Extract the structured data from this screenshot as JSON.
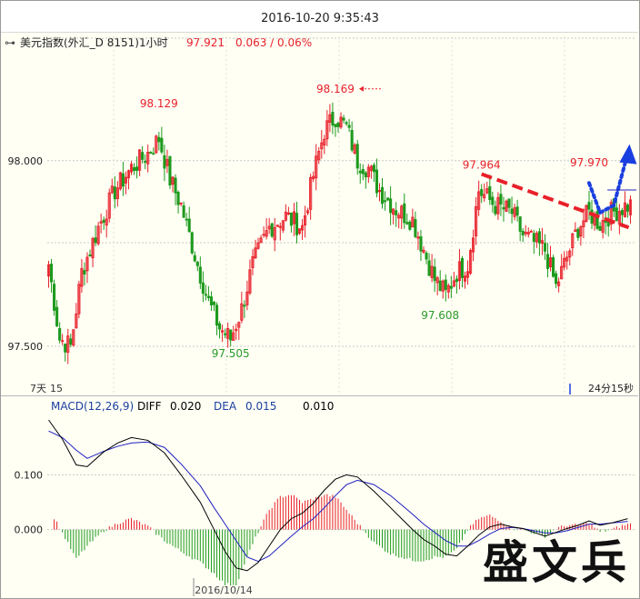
{
  "header": {
    "datetime": "2016-10-20 9:35:43",
    "menu_glyph": "⊶",
    "instrument": "美元指数(外汇_D 8151)1小时",
    "last_price": "97.921",
    "change": "0.063 / 0.06%"
  },
  "footer": {
    "countdown": "24分15秒",
    "left_fragment": "7天",
    "left_value": "15",
    "date_label": "2016/10/14"
  },
  "watermark": {
    "text": "盛文兵"
  },
  "colors": {
    "up": "#e8202a",
    "down": "#1e9a1e",
    "price_red": "#e8202a",
    "price_green": "#2a9a2a",
    "trendline": "#e8202a",
    "forecast_arrow": "#1a3fe0",
    "macd_line": "#000000",
    "signal_line": "#2020c0",
    "grid": "#c8c8c8",
    "panel_bg": "#fffff4"
  },
  "chart_data": [
    {
      "type": "candlestick",
      "yticks": [
        97.5,
        98.0
      ],
      "ytick_labels": [
        "97.500",
        "98.000"
      ],
      "ylim": [
        97.38,
        98.33
      ],
      "grid": true,
      "annotations": [
        {
          "text": "98.129",
          "x": 40,
          "y": 98.129,
          "color": "red"
        },
        {
          "text": "98.169",
          "x": 104,
          "y": 98.169,
          "color": "red"
        },
        {
          "text": "97.505",
          "x": 66,
          "y": 97.505,
          "color": "green"
        },
        {
          "text": "97.608",
          "x": 142,
          "y": 97.608,
          "color": "green"
        },
        {
          "text": "97.964",
          "x": 157,
          "y": 97.964,
          "color": "red"
        },
        {
          "text": "97.970",
          "x": 196,
          "y": 97.97,
          "color": "red"
        }
      ],
      "trendline": {
        "from": [
          157,
          97.964
        ],
        "to": [
          213,
          97.82
        ],
        "style": "dashed"
      },
      "forecast": {
        "points": [
          [
            196,
            97.94
          ],
          [
            200,
            97.86
          ],
          [
            205,
            97.88
          ],
          [
            210,
            98.02
          ]
        ],
        "style": "dotted-arrow"
      }
    },
    {
      "type": "macd",
      "title": "MACD(12,26,9)",
      "params": {
        "fast": 12,
        "slow": 26,
        "signal": 9
      },
      "diff_label": "DIFF",
      "diff": "0.020",
      "dea_label": "DEA",
      "dea": "0.015",
      "macd_value": "0.010",
      "yticks": [
        0.0,
        0.1
      ],
      "ytick_labels": [
        "0.000",
        "0.100"
      ],
      "ylim": [
        -0.12,
        0.24
      ],
      "diff_series": [
        [
          0,
          0.2
        ],
        [
          5,
          0.165
        ],
        [
          10,
          0.118
        ],
        [
          14,
          0.115
        ],
        [
          20,
          0.142
        ],
        [
          25,
          0.158
        ],
        [
          30,
          0.168
        ],
        [
          36,
          0.163
        ],
        [
          42,
          0.14
        ],
        [
          48,
          0.1
        ],
        [
          55,
          0.05
        ],
        [
          60,
          0.0
        ],
        [
          64,
          -0.04
        ],
        [
          68,
          -0.07
        ],
        [
          72,
          -0.075
        ],
        [
          76,
          -0.06
        ],
        [
          80,
          -0.03
        ],
        [
          84,
          0.0
        ],
        [
          88,
          0.02
        ],
        [
          92,
          0.03
        ],
        [
          96,
          0.048
        ],
        [
          100,
          0.072
        ],
        [
          104,
          0.092
        ],
        [
          108,
          0.1
        ],
        [
          112,
          0.096
        ],
        [
          118,
          0.07
        ],
        [
          124,
          0.04
        ],
        [
          128,
          0.02
        ],
        [
          132,
          0.0
        ],
        [
          136,
          -0.018
        ],
        [
          140,
          -0.03
        ],
        [
          144,
          -0.045
        ],
        [
          148,
          -0.048
        ],
        [
          152,
          -0.03
        ],
        [
          156,
          -0.01
        ],
        [
          160,
          0.005
        ],
        [
          164,
          0.01
        ],
        [
          168,
          0.005
        ],
        [
          172,
          0.002
        ],
        [
          176,
          -0.005
        ],
        [
          180,
          -0.012
        ],
        [
          184,
          -0.005
        ],
        [
          188,
          0.002
        ],
        [
          192,
          0.008
        ],
        [
          196,
          0.016
        ],
        [
          200,
          0.008
        ],
        [
          204,
          0.012
        ],
        [
          210,
          0.02
        ]
      ],
      "dea_series": [
        [
          0,
          0.18
        ],
        [
          5,
          0.168
        ],
        [
          10,
          0.145
        ],
        [
          14,
          0.13
        ],
        [
          20,
          0.143
        ],
        [
          25,
          0.152
        ],
        [
          30,
          0.158
        ],
        [
          36,
          0.16
        ],
        [
          42,
          0.15
        ],
        [
          48,
          0.12
        ],
        [
          55,
          0.08
        ],
        [
          60,
          0.04
        ],
        [
          64,
          0.01
        ],
        [
          68,
          -0.02
        ],
        [
          72,
          -0.05
        ],
        [
          76,
          -0.058
        ],
        [
          80,
          -0.048
        ],
        [
          84,
          -0.03
        ],
        [
          88,
          -0.012
        ],
        [
          92,
          0.005
        ],
        [
          96,
          0.02
        ],
        [
          100,
          0.04
        ],
        [
          104,
          0.062
        ],
        [
          108,
          0.082
        ],
        [
          112,
          0.09
        ],
        [
          118,
          0.082
        ],
        [
          124,
          0.062
        ],
        [
          128,
          0.045
        ],
        [
          132,
          0.028
        ],
        [
          136,
          0.01
        ],
        [
          140,
          -0.005
        ],
        [
          144,
          -0.02
        ],
        [
          148,
          -0.03
        ],
        [
          152,
          -0.03
        ],
        [
          156,
          -0.02
        ],
        [
          160,
          -0.008
        ],
        [
          164,
          0.002
        ],
        [
          168,
          0.004
        ],
        [
          172,
          0.002
        ],
        [
          176,
          -0.002
        ],
        [
          180,
          -0.006
        ],
        [
          184,
          -0.006
        ],
        [
          188,
          -0.002
        ],
        [
          192,
          0.004
        ],
        [
          196,
          0.01
        ],
        [
          200,
          0.01
        ],
        [
          204,
          0.012
        ],
        [
          210,
          0.015
        ]
      ]
    }
  ]
}
